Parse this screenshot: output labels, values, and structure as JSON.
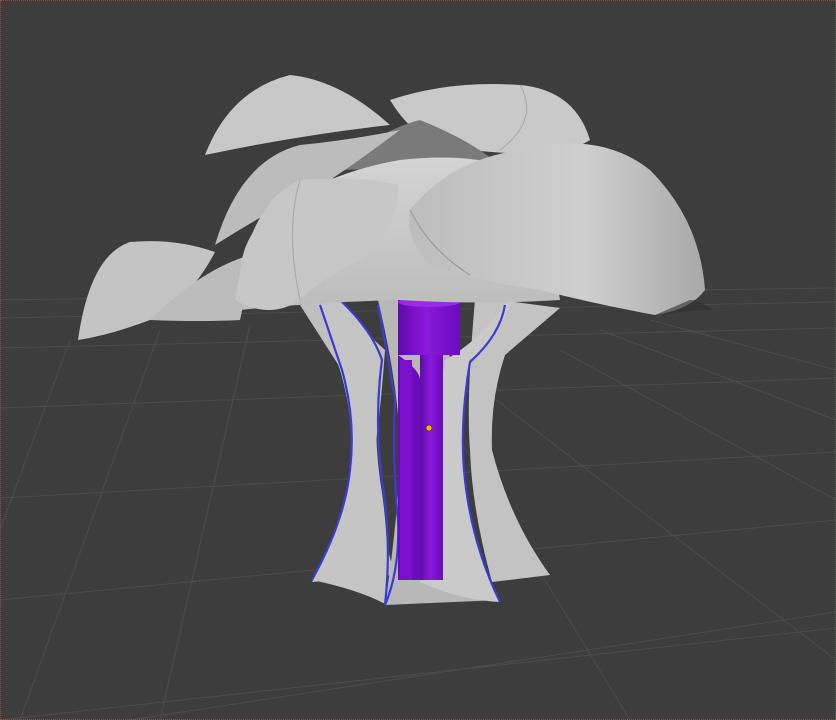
{
  "viewport": {
    "background": "#3d3d3d",
    "grid_color": "#4d4d4d",
    "border_color": "#9a4a4a"
  },
  "scene": {
    "tree_canopy_color": "#c6c6c6",
    "canopy_shadow_color": "#8e8e8e",
    "trunk_fin_color": "#c2c2c2",
    "selected_object_color": "#7a10cc",
    "selection_outline_color": "#3b3bd1",
    "object_origin_color": "#f0b81a"
  }
}
